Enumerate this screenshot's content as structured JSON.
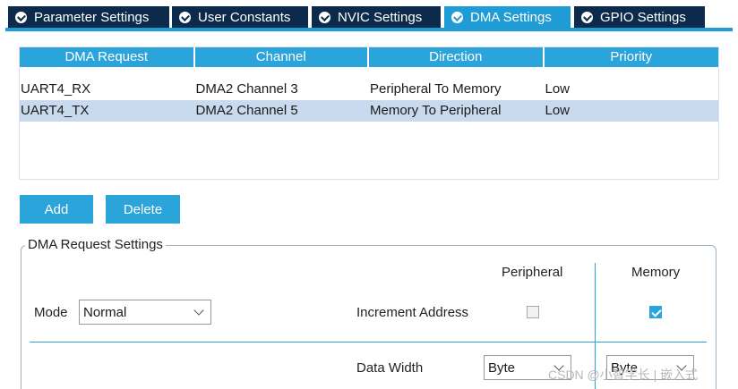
{
  "tabs": [
    {
      "label": "Parameter Settings",
      "active": false
    },
    {
      "label": "User Constants",
      "active": false
    },
    {
      "label": "NVIC Settings",
      "active": false
    },
    {
      "label": "DMA Settings",
      "active": true
    },
    {
      "label": "GPIO Settings",
      "active": false
    }
  ],
  "dma_table": {
    "columns": [
      "DMA Request",
      "Channel",
      "Direction",
      "Priority"
    ],
    "rows": [
      [
        "UART4_RX",
        "DMA2 Channel 3",
        "Peripheral To Memory",
        "Low"
      ],
      [
        "UART4_TX",
        "DMA2 Channel 5",
        "Memory To Peripheral",
        "Low"
      ]
    ],
    "selected_row": 1
  },
  "buttons": {
    "add": "Add",
    "delete": "Delete"
  },
  "settings": {
    "legend": "DMA Request Settings",
    "mode_label": "Mode",
    "mode_value": "Normal",
    "peripheral_header": "Peripheral",
    "memory_header": "Memory",
    "increment_label": "Increment Address",
    "peripheral_increment": false,
    "memory_increment": true,
    "data_width_label": "Data Width",
    "peripheral_width": "Byte",
    "memory_width": "Byte"
  },
  "watermark": "CSDN @小智学长 | 嵌入式",
  "colors": {
    "tab_dark": "#0c2a4b",
    "accent": "#2ba4dc",
    "selection": "#c9d9ee"
  }
}
